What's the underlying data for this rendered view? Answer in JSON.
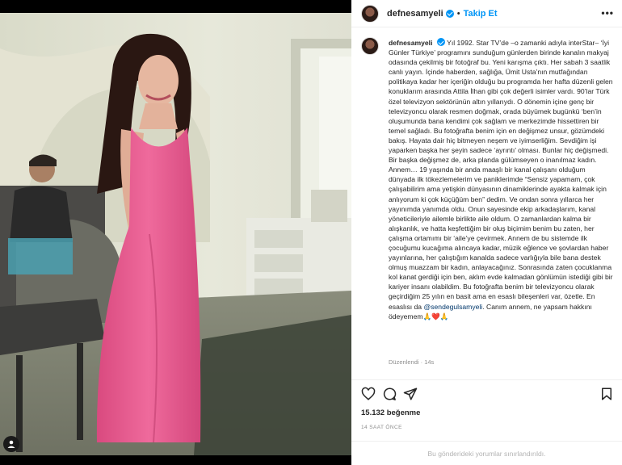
{
  "post": {
    "username": "defnesamyeli",
    "follow_label": "Takip Et",
    "separator": "•",
    "more_label": "•••",
    "caption_username": "defnesamyeli",
    "caption_before_mention": "Yıl 1992. Star TV’de –o zamanki adıyla interStar– ‘İyi Günler Türkiye’ programını sunduğum günlerden birinde kanalın makyaj odasında çekilmiş bir fotoğraf bu. Yeni karışma çıktı. Her sabah 3 saatlik canlı yayın. İçinde haberden, sağlığa, Ümit Usta’nın mutfağından politikaya kadar her içeriğin olduğu bu programda her hafta düzenli gelen konuklarım arasında Attila İlhan gibi çok değerli isimler vardı. 90’lar Türk özel televizyon sektörünün altın yıllarıydı. O dönemin içine genç bir televizyoncu olarak resmen doğmak, orada büyümek bugünkü ‘ben’in oluşumunda bana kendimi çok sağlam ve merkezimde hissettiren bir temel sağladı. Bu fotoğrafta benim için en değişmez unsur, gözümdeki bakış. Hayata dair hiç bitmeyen neşem ve iyimserliğim. Sevdiğim işi yaparken başka her şeyin sadece ‘ayrıntı’ olması. Bunlar hiç değişmedi. Bir başka değişmez de, arka planda gülümseyen o inanılmaz kadın. Annem… 19 yaşında bir anda maaşlı bir kanal çalışanı olduğum dünyada ilk tökezlemelerim ve paniklerimde “Sensiz yapamam, çok çalışabilirim ama yetişkin dünyasının dinamiklerinde ayakta kalmak için anlıyorum ki çok küçüğüm ben” dedim. Ve ondan sonra yıllarca her yayınımda yanımda oldu. Onun sayesinde ekip arkadaşlarım, kanal yöneticileriyle ailemle birlikte aile oldum. O zamanlardan kalma bir alışkanlık, ve hatta keşfettiğim bir oluş biçimim benim bu zaten, her çalışma ortamımı bir ‘aile’ye çevirmek. Annem de bu sistemde ilk çocuğumu kucağıma alıncaya kadar, müzik eğlence ve şovlardan haber yayınlarına, her çalıştığım kanalda sadece varlığıyla bile bana destek olmuş muazzam bir kadın, anlayacağınız. Sonrasında zaten çocuklanma kol kanat gerdiği için ben, aklım evde kalmadan gönlümün istediği gibi bir kariyer insanı olabildim. Bu fotoğrafta benim bir televizyoncu olarak geçirdiğim 25 yılın en basit ama en esaslı bileşenleri var, özetle. En esaslısı da",
    "mention": "@sendegulsamyeli",
    "caption_after_mention": ". Canım annem, ne yapsam hakkını ödeyemem🙏❤️🙏",
    "edited_label": "Düzenlendi · 14s",
    "likes": "15.132 beğenme",
    "timestamp": "14 SAAT ÖNCE",
    "comments_disabled": "Bu gönderideki yorumlar sınırlandırıldı."
  },
  "icons": {
    "like": "heart-outline-icon",
    "comment": "comment-bubble-icon",
    "share": "paper-plane-icon",
    "save": "bookmark-icon",
    "more": "ellipsis-icon",
    "tagged_user": "user-silhouette-icon"
  },
  "colors": {
    "accent": "#0095f6",
    "mention": "#00376b",
    "muted": "#8e8e8e",
    "dress": "#e2578a"
  }
}
